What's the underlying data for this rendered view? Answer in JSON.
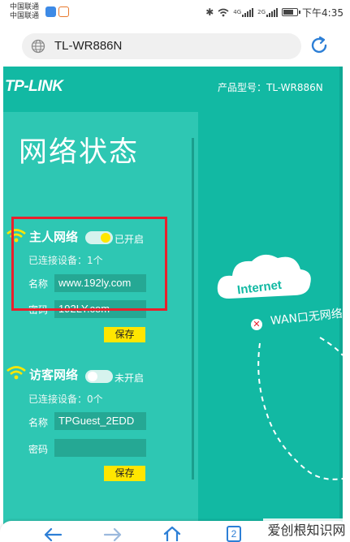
{
  "status_bar": {
    "carrier_1": "中国联通",
    "carrier_2": "中国联通",
    "network_1": "4G",
    "network_2": "2G",
    "time": "下午4:35",
    "battery_level": 0.8
  },
  "browser": {
    "url": "TL-WR886N",
    "icons": {
      "site": "globe-icon",
      "reload": "reload-icon"
    }
  },
  "router_page": {
    "logo": "TP-LINK",
    "model_label": "产品型号：TL-WR886N",
    "title": "网络状态",
    "host_network": {
      "title": "主人网络",
      "toggle_on": true,
      "toggle_state": "已开启",
      "devices": "已连接设备：1个",
      "name_label": "名称",
      "name_value": "www.192ly.com",
      "password_label": "密码",
      "password_value": "192LY.com",
      "save_label": "保存"
    },
    "guest_network": {
      "title": "访客网络",
      "toggle_on": false,
      "toggle_state": "未开启",
      "devices": "已连接设备：0个",
      "name_label": "名称",
      "name_value": "TPGuest_2EDD",
      "password_label": "密码",
      "password_value": "",
      "save_label": "保存"
    },
    "diagram": {
      "internet_label": "Internet",
      "wan_status": "WAN口无网络"
    }
  },
  "bottom_nav": {
    "tab_count": "2"
  },
  "watermark": "爱创根知识网",
  "colors": {
    "page_bg": "#12b9a3",
    "panel_bg": "#2ec7b3",
    "field_bg": "#25a894",
    "button_yellow": "#ffe600",
    "highlight_red": "#e8212d",
    "accent_blue": "#2d7fd6"
  }
}
